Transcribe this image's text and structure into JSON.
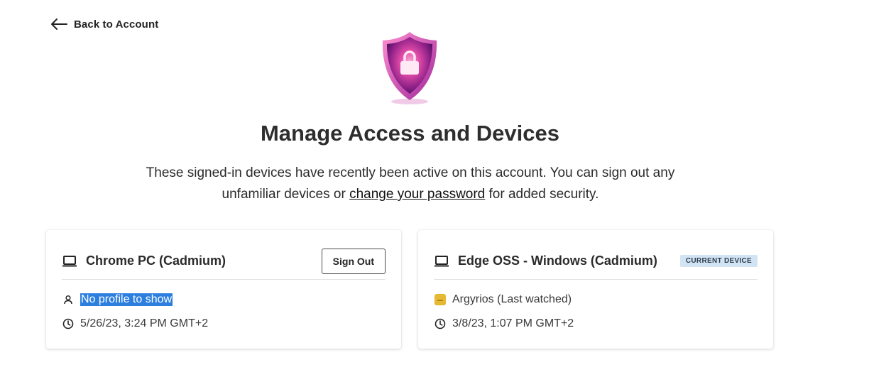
{
  "nav": {
    "back_label": "Back to Account"
  },
  "header": {
    "title": "Manage Access and Devices",
    "description_part1": "These signed-in devices have recently been active on this account. You can sign out any unfamiliar devices or ",
    "description_link": "change your password",
    "description_part2": " for added security."
  },
  "devices": [
    {
      "name": "Chrome PC (Cadmium)",
      "action_label": "Sign Out",
      "profile": "No profile to show",
      "last_active": "5/26/23, 3:24 PM GMT+2",
      "icon": "laptop-icon"
    },
    {
      "name": "Edge OSS - Windows (Cadmium)",
      "badge": "CURRENT DEVICE",
      "profile": "Argyrios (Last watched)",
      "last_active": "3/8/23, 1:07 PM GMT+2",
      "icon": "laptop-icon"
    }
  ],
  "colors": {
    "badge_bg": "#d2e3f3",
    "selection": "#2c7fdf",
    "profile_avatar": "#e5b934",
    "shield_primary": "#c2379a"
  }
}
